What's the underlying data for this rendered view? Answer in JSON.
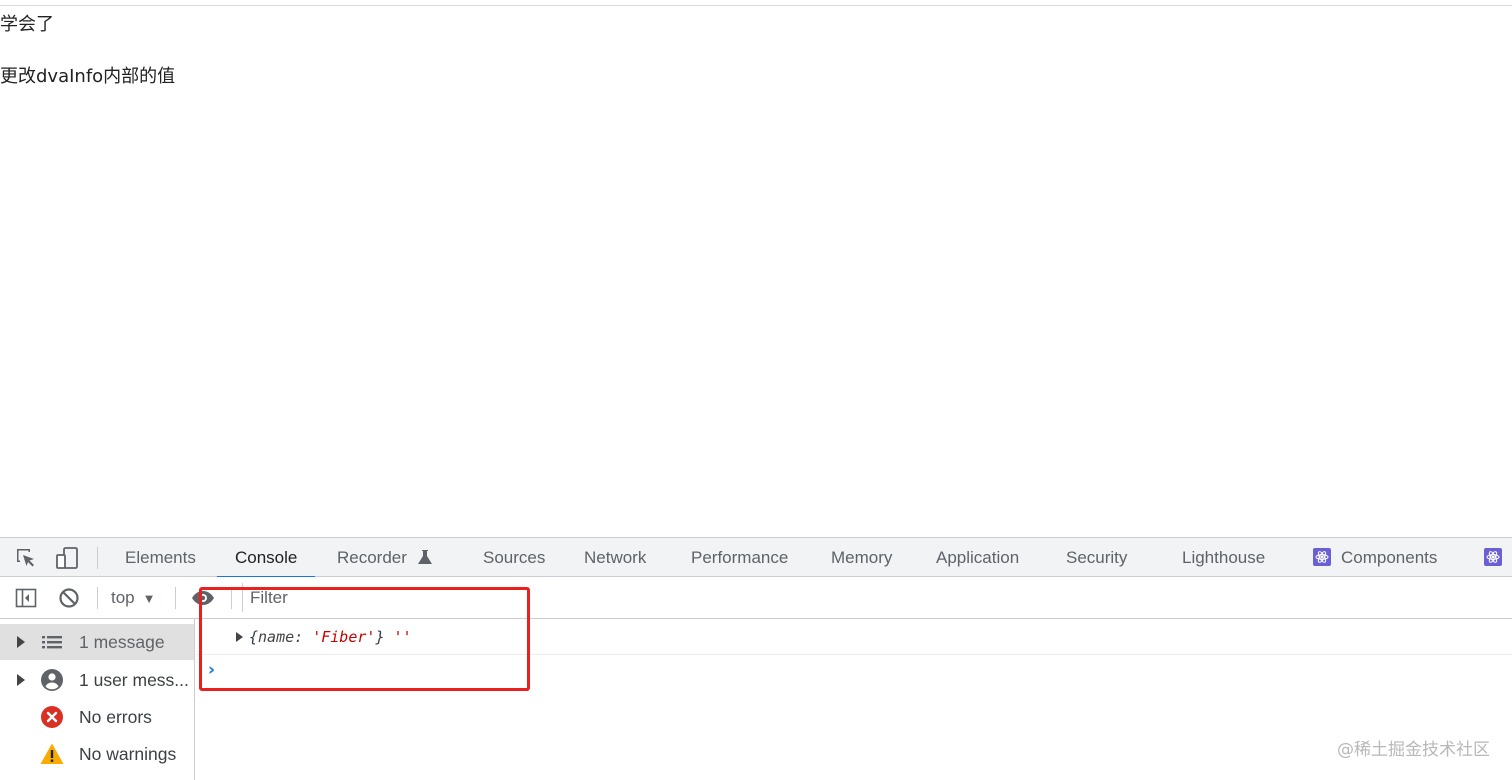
{
  "page": {
    "line1": "学会了",
    "line2": "更改dvaInfo内部的值"
  },
  "devtools": {
    "tabs": [
      {
        "label": "Elements",
        "active": false
      },
      {
        "label": "Console",
        "active": true
      },
      {
        "label": "Recorder",
        "active": false,
        "icon": "flask-icon"
      },
      {
        "label": "Sources",
        "active": false
      },
      {
        "label": "Network",
        "active": false
      },
      {
        "label": "Performance",
        "active": false
      },
      {
        "label": "Memory",
        "active": false
      },
      {
        "label": "Application",
        "active": false
      },
      {
        "label": "Security",
        "active": false
      },
      {
        "label": "Lighthouse",
        "active": false
      },
      {
        "label": "Components",
        "active": false,
        "icon": "react-icon"
      }
    ],
    "toolbar": {
      "context": "top",
      "filter_placeholder": "Filter"
    },
    "sidebar": [
      {
        "label": "1 message",
        "icon": "list-icon",
        "expandable": true,
        "selected": true
      },
      {
        "label": "1 user mess...",
        "icon": "user-icon",
        "expandable": true,
        "selected": false
      },
      {
        "label": "No errors",
        "icon": "error-icon",
        "expandable": false,
        "selected": false
      },
      {
        "label": "No warnings",
        "icon": "warning-icon",
        "expandable": false,
        "selected": false
      }
    ],
    "console": {
      "log_open": "{",
      "log_key": "name: ",
      "log_string": "'Fiber'",
      "log_close": "} ",
      "log_extra": "''"
    },
    "prompt": "›"
  },
  "watermark": "@稀土掘金技术社区",
  "colors": {
    "accent": "#1a73e8",
    "highlight": "#e8201e",
    "string": "#c80000",
    "error": "#d93025",
    "warning": "#f9ab00",
    "react": "#6b5fd6"
  }
}
